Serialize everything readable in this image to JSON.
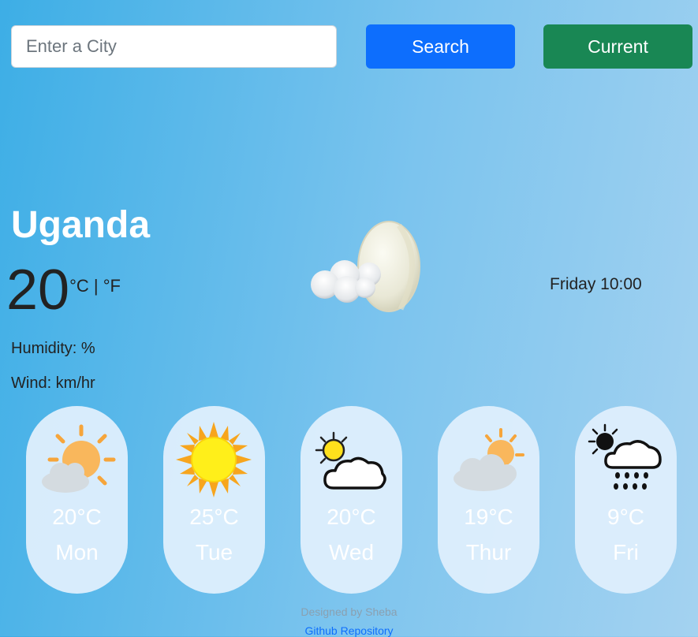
{
  "search": {
    "placeholder": "Enter a City",
    "value": ""
  },
  "buttons": {
    "search_label": "Search",
    "current_label": "Current"
  },
  "current": {
    "city": "Uganda",
    "temperature": "20",
    "unit_celsius": "°C",
    "unit_separator": " | ",
    "unit_fahrenheit": "°F",
    "humidity": "Humidity: %",
    "wind": "Wind: km/hr",
    "datetime": "Friday 10:00",
    "icon": "cloud-moon-icon"
  },
  "forecast": [
    {
      "temp": "20°C",
      "day": "Mon",
      "icon": "partly-sunny-icon"
    },
    {
      "temp": "25°C",
      "day": "Tue",
      "icon": "sun-icon"
    },
    {
      "temp": "20°C",
      "day": "Wed",
      "icon": "sun-behind-cloud-icon"
    },
    {
      "temp": "19°C",
      "day": "Thur",
      "icon": "cloud-sun-icon"
    },
    {
      "temp": "9°C",
      "day": "Fri",
      "icon": "rain-icon"
    }
  ],
  "footer": {
    "credit": "Designed by Sheba",
    "link_text": "Github Repository"
  },
  "colors": {
    "search_button": "#0d6efd",
    "current_button": "#198754",
    "card": "#deeefc"
  }
}
